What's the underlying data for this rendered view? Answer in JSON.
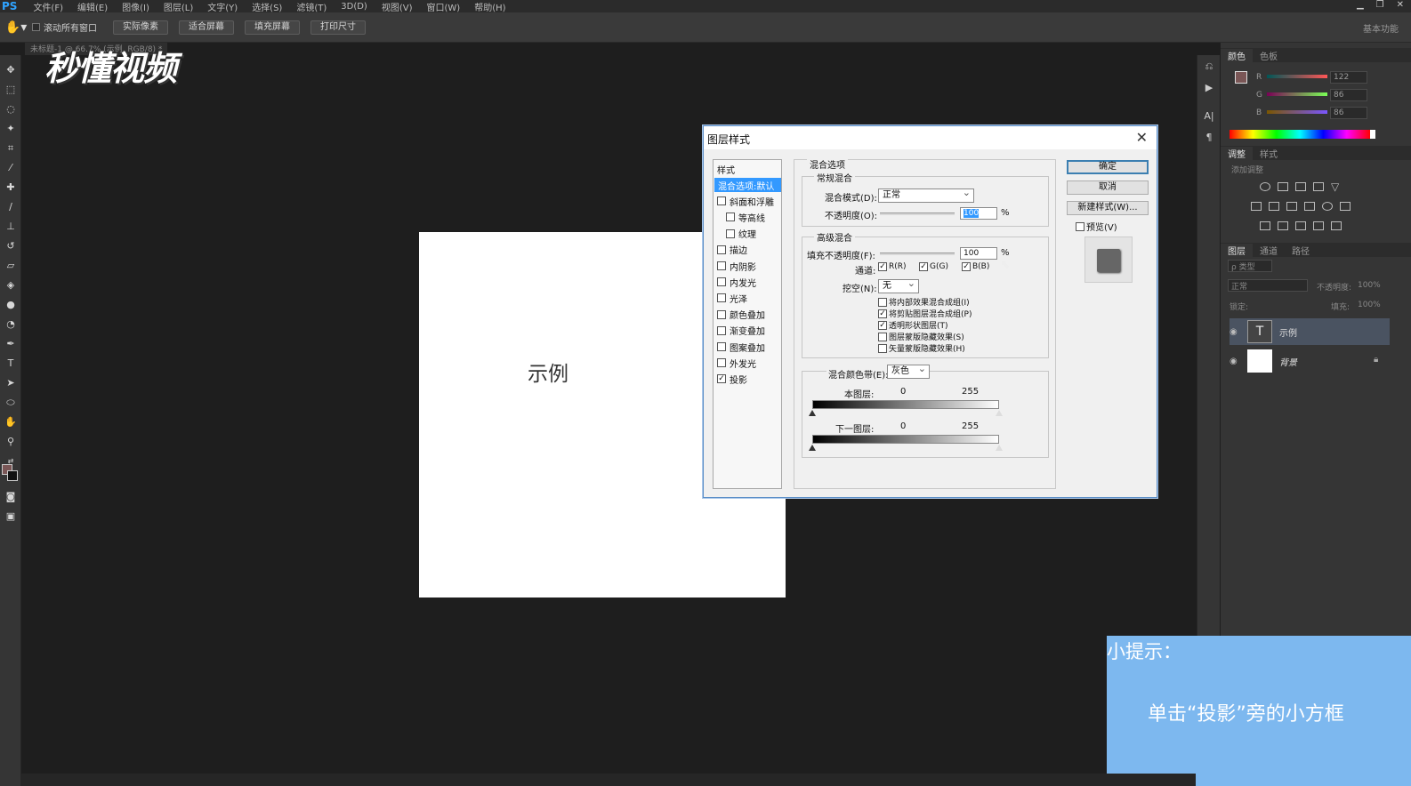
{
  "app": {
    "logo_text": "PS",
    "menu": [
      "文件(F)",
      "编辑(E)",
      "图像(I)",
      "图层(L)",
      "文字(Y)",
      "选择(S)",
      "滤镜(T)",
      "3D(D)",
      "视图(V)",
      "窗口(W)",
      "帮助(H)"
    ]
  },
  "options_bar": {
    "scroll_all_label": "滚动所有窗口",
    "buttons": [
      "实际像素",
      "适合屏幕",
      "填充屏幕",
      "打印尺寸"
    ],
    "workspace": "基本功能"
  },
  "doc_tab": "未标题-1 @ 66.7% (示例, RGB/8) *",
  "logo": "秒懂视频",
  "canvas": {
    "text": "示例"
  },
  "color_panel": {
    "tabs": [
      "颜色",
      "色板"
    ],
    "channels": [
      {
        "name": "R",
        "value": "122"
      },
      {
        "name": "G",
        "value": "86"
      },
      {
        "name": "B",
        "value": "86"
      }
    ],
    "fg_color": "#7a5656"
  },
  "adjust_panel": {
    "tabs": [
      "调整",
      "样式"
    ],
    "hint": "添加调整"
  },
  "layers_panel": {
    "tabs": [
      "图层",
      "通道",
      "路径"
    ],
    "kind_label": "ρ 类型",
    "blend_mode": "正常",
    "opacity_label": "不透明度:",
    "opacity_value": "100%",
    "lock_label": "锁定:",
    "fill_label": "填充:",
    "fill_value": "100%",
    "layers": [
      {
        "name": "示例",
        "type": "text",
        "selected": true
      },
      {
        "name": "背景",
        "type": "background",
        "selected": false
      }
    ]
  },
  "dialog": {
    "title": "图层样式",
    "styles_header": "样式",
    "styles": [
      {
        "label": "混合选项:默认",
        "selected": true,
        "checkbox": false,
        "checked": false,
        "indent": false
      },
      {
        "label": "斜面和浮雕",
        "selected": false,
        "checkbox": true,
        "checked": false,
        "indent": false
      },
      {
        "label": "等高线",
        "selected": false,
        "checkbox": true,
        "checked": false,
        "indent": true
      },
      {
        "label": "纹理",
        "selected": false,
        "checkbox": true,
        "checked": false,
        "indent": true
      },
      {
        "label": "描边",
        "selected": false,
        "checkbox": true,
        "checked": false,
        "indent": false
      },
      {
        "label": "内阴影",
        "selected": false,
        "checkbox": true,
        "checked": false,
        "indent": false
      },
      {
        "label": "内发光",
        "selected": false,
        "checkbox": true,
        "checked": false,
        "indent": false
      },
      {
        "label": "光泽",
        "selected": false,
        "checkbox": true,
        "checked": false,
        "indent": false
      },
      {
        "label": "颜色叠加",
        "selected": false,
        "checkbox": true,
        "checked": false,
        "indent": false
      },
      {
        "label": "渐变叠加",
        "selected": false,
        "checkbox": true,
        "checked": false,
        "indent": false
      },
      {
        "label": "图案叠加",
        "selected": false,
        "checkbox": true,
        "checked": false,
        "indent": false
      },
      {
        "label": "外发光",
        "selected": false,
        "checkbox": true,
        "checked": false,
        "indent": false
      },
      {
        "label": "投影",
        "selected": false,
        "checkbox": true,
        "checked": true,
        "indent": false
      }
    ],
    "blend_options_title": "混合选项",
    "general_title": "常规混合",
    "blend_mode_label": "混合模式(D):",
    "blend_mode_value": "正常",
    "opacity_label": "不透明度(O):",
    "opacity_value": "100",
    "percent": "%",
    "advanced_title": "高级混合",
    "fill_opacity_label": "填充不透明度(F):",
    "fill_opacity_value": "100",
    "channels_label": "通道:",
    "channels": [
      {
        "label": "R(R)",
        "checked": true
      },
      {
        "label": "G(G)",
        "checked": true
      },
      {
        "label": "B(B)",
        "checked": true
      }
    ],
    "knockout_label": "挖空(N):",
    "knockout_value": "无",
    "options": [
      {
        "label": "将内部效果混合成组(I)",
        "checked": false
      },
      {
        "label": "将剪贴图层混合成组(P)",
        "checked": true
      },
      {
        "label": "透明形状图层(T)",
        "checked": true
      },
      {
        "label": "图层蒙版隐藏效果(S)",
        "checked": false
      },
      {
        "label": "矢量蒙版隐藏效果(H)",
        "checked": false
      }
    ],
    "blend_if_label": "混合颜色带(E):",
    "blend_if_value": "灰色",
    "this_layer_label": "本图层:",
    "this_layer_min": "0",
    "this_layer_max": "255",
    "underlying_label": "下一图层:",
    "underlying_min": "0",
    "underlying_max": "255",
    "ok": "确定",
    "cancel": "取消",
    "new_style": "新建样式(W)...",
    "preview_label": "预览(V)",
    "preview_checked": false
  },
  "tip": {
    "title": "小提示：",
    "body": "单击“投影”旁的小方框"
  }
}
